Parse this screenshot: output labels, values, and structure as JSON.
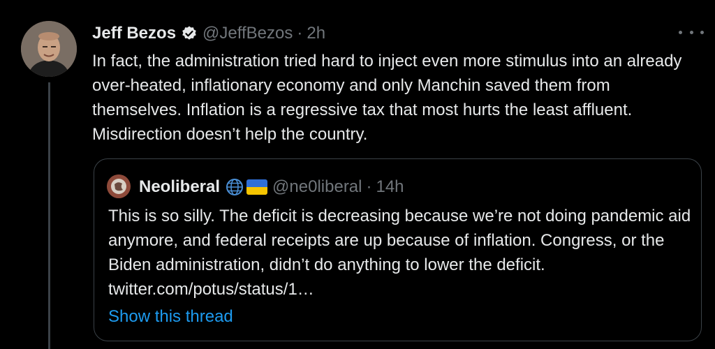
{
  "tweet": {
    "author_name": "Jeff Bezos",
    "handle": "@JeffBezos",
    "separator": "·",
    "time": "2h",
    "text": "In fact, the administration tried hard to inject even more stimulus into an already over-heated, inflationary economy and only Manchin saved them from themselves. Inflation is a regressive tax that most hurts the least affluent. Misdirection doesn’t help the country.",
    "icons": {
      "verified": "verified-badge-icon",
      "more": "more-options-icon"
    }
  },
  "quoted_tweet": {
    "author_name": "Neoliberal",
    "handle": "@ne0liberal",
    "separator": "·",
    "time": "14h",
    "text": "This is so silly. The deficit is decreasing because we’re not doing pandemic aid anymore, and federal receipts are up because of inflation. Congress, or the Biden administration, didn’t do anything to lower the deficit. twitter.com/potus/status/1…",
    "show_thread_label": "Show this thread",
    "icons": {
      "globe": "globe-icon",
      "flag": "ukraine-flag-icon"
    }
  },
  "colors": {
    "background": "#000000",
    "text_primary": "#e7e9ea",
    "text_secondary": "#71767b",
    "link": "#1d9bf0",
    "border": "#3b4248"
  }
}
